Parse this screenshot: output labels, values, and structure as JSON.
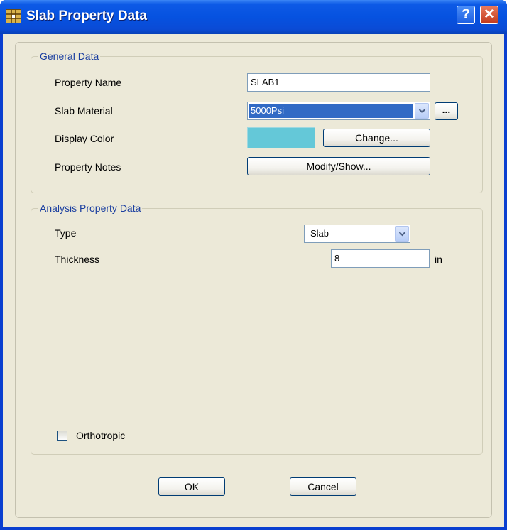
{
  "window": {
    "title": "Slab Property Data",
    "help_label": "?",
    "close_label": "✕"
  },
  "general": {
    "caption": "General Data",
    "property_name_label": "Property Name",
    "property_name_value": "SLAB1",
    "slab_material_label": "Slab Material",
    "slab_material_value": "5000Psi",
    "material_browse_label": "...",
    "display_color_label": "Display Color",
    "display_color": "#64c8d8",
    "change_label": "Change...",
    "property_notes_label": "Property Notes",
    "modify_show_label": "Modify/Show..."
  },
  "analysis": {
    "caption": "Analysis Property Data",
    "type_label": "Type",
    "type_value": "Slab",
    "thickness_label": "Thickness",
    "thickness_value": "8",
    "thickness_unit": "in",
    "orthotropic_label": "Orthotropic",
    "orthotropic_checked": false
  },
  "buttons": {
    "ok_label": "OK",
    "cancel_label": "Cancel"
  }
}
